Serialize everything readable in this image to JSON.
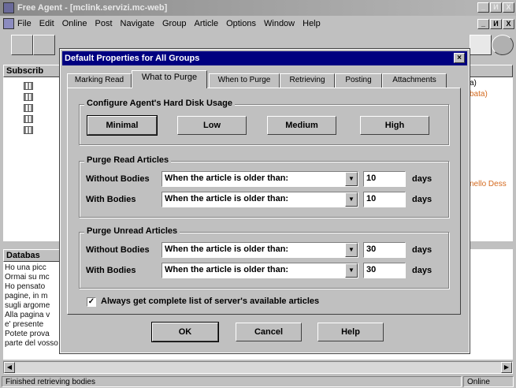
{
  "app": {
    "title": "Free Agent - [mclink.servizi.mc-web]",
    "win_controls": [
      "_",
      "И",
      "X"
    ]
  },
  "menu": [
    "File",
    "Edit",
    "Online",
    "Post",
    "Navigate",
    "Group",
    "Article",
    "Options",
    "Window",
    "Help"
  ],
  "panes": {
    "subscribed_header": "Subscrib",
    "database_header": "Databas",
    "right_snippets": [
      "a)",
      "bata)",
      "nello Dess"
    ],
    "database_lines": [
      "Ho una picc",
      "Ormai su mc",
      "Ho pensato",
      "pagine, in m",
      "sugli argome",
      "Alla pagina v",
      "e' presente",
      "Potete prova",
      "parte del vosso"
    ]
  },
  "status": {
    "left": "Finished retrieving bodies",
    "right": "Online"
  },
  "dialog": {
    "title": "Default Properties for All Groups",
    "close": "×",
    "tabs": [
      "Marking Read",
      "What to Purge",
      "When to Purge",
      "Retrieving",
      "Posting",
      "Attachments"
    ],
    "active_tab": 1,
    "disk": {
      "title": "Configure Agent's Hard Disk Usage",
      "buttons": [
        "Minimal",
        "Low",
        "Medium",
        "High"
      ]
    },
    "purge_read": {
      "title": "Purge Read Articles",
      "rows": [
        {
          "label": "Without Bodies",
          "condition": "When the article is older than:",
          "value": "10",
          "unit": "days"
        },
        {
          "label": "With Bodies",
          "condition": "When the article is older than:",
          "value": "10",
          "unit": "days"
        }
      ]
    },
    "purge_unread": {
      "title": "Purge Unread Articles",
      "rows": [
        {
          "label": "Without Bodies",
          "condition": "When the article is older than:",
          "value": "30",
          "unit": "days"
        },
        {
          "label": "With Bodies",
          "condition": "When the article is older than:",
          "value": "30",
          "unit": "days"
        }
      ]
    },
    "always_get": {
      "checked": true,
      "label": "Always get complete list of server's available articles"
    },
    "footer_buttons": [
      "OK",
      "Cancel",
      "Help"
    ]
  }
}
